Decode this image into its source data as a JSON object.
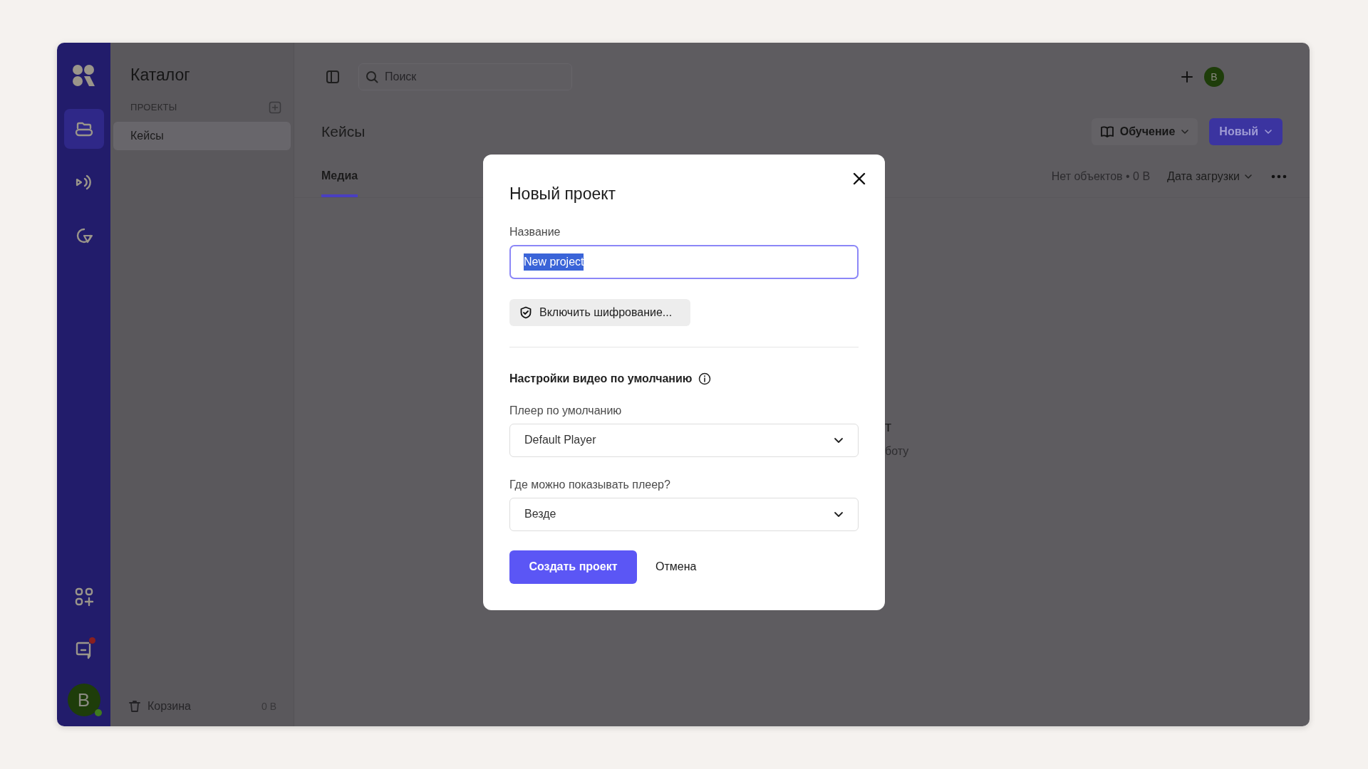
{
  "rail": {
    "items": [
      {
        "selected": false,
        "notification": false
      },
      {
        "selected": true,
        "notification": false
      },
      {
        "selected": false,
        "notification": false
      },
      {
        "selected": false,
        "notification": false
      },
      {
        "selected": false,
        "notification": false
      },
      {
        "selected": false,
        "notification": true
      }
    ],
    "avatar": {
      "initial": "B",
      "online": true
    }
  },
  "catalog": {
    "title": "Каталог",
    "section_label": "ПРОЕКТЫ",
    "projects": [
      {
        "name": "Кейсы",
        "selected": true
      }
    ],
    "trash": {
      "label": "Корзина",
      "size": "0 B"
    }
  },
  "topbar": {
    "search_placeholder": "Поиск",
    "avatar_initial": "B"
  },
  "page": {
    "title": "Кейсы",
    "learn_button": "Обучение",
    "new_button": "Новый",
    "tabs": [
      {
        "label": "Медиа",
        "selected": true
      }
    ],
    "summary": "Нет объектов • 0 B",
    "sort": "Дата загрузки",
    "empty_state_fragments": [
      "т",
      "боту"
    ]
  },
  "dialog": {
    "title": "Новый проект",
    "name_label": "Название",
    "name_value": "New project",
    "name_text_selected": true,
    "encrypt_button": "Включить шифрование...",
    "section_title": "Настройки видео по умолчанию",
    "fields": [
      {
        "label": "Плеер по умолчанию",
        "value": "Default Player"
      },
      {
        "label": "Где можно показывать плеер?",
        "value": "Везде"
      }
    ],
    "submit": "Создать проект",
    "cancel": "Отмена"
  }
}
